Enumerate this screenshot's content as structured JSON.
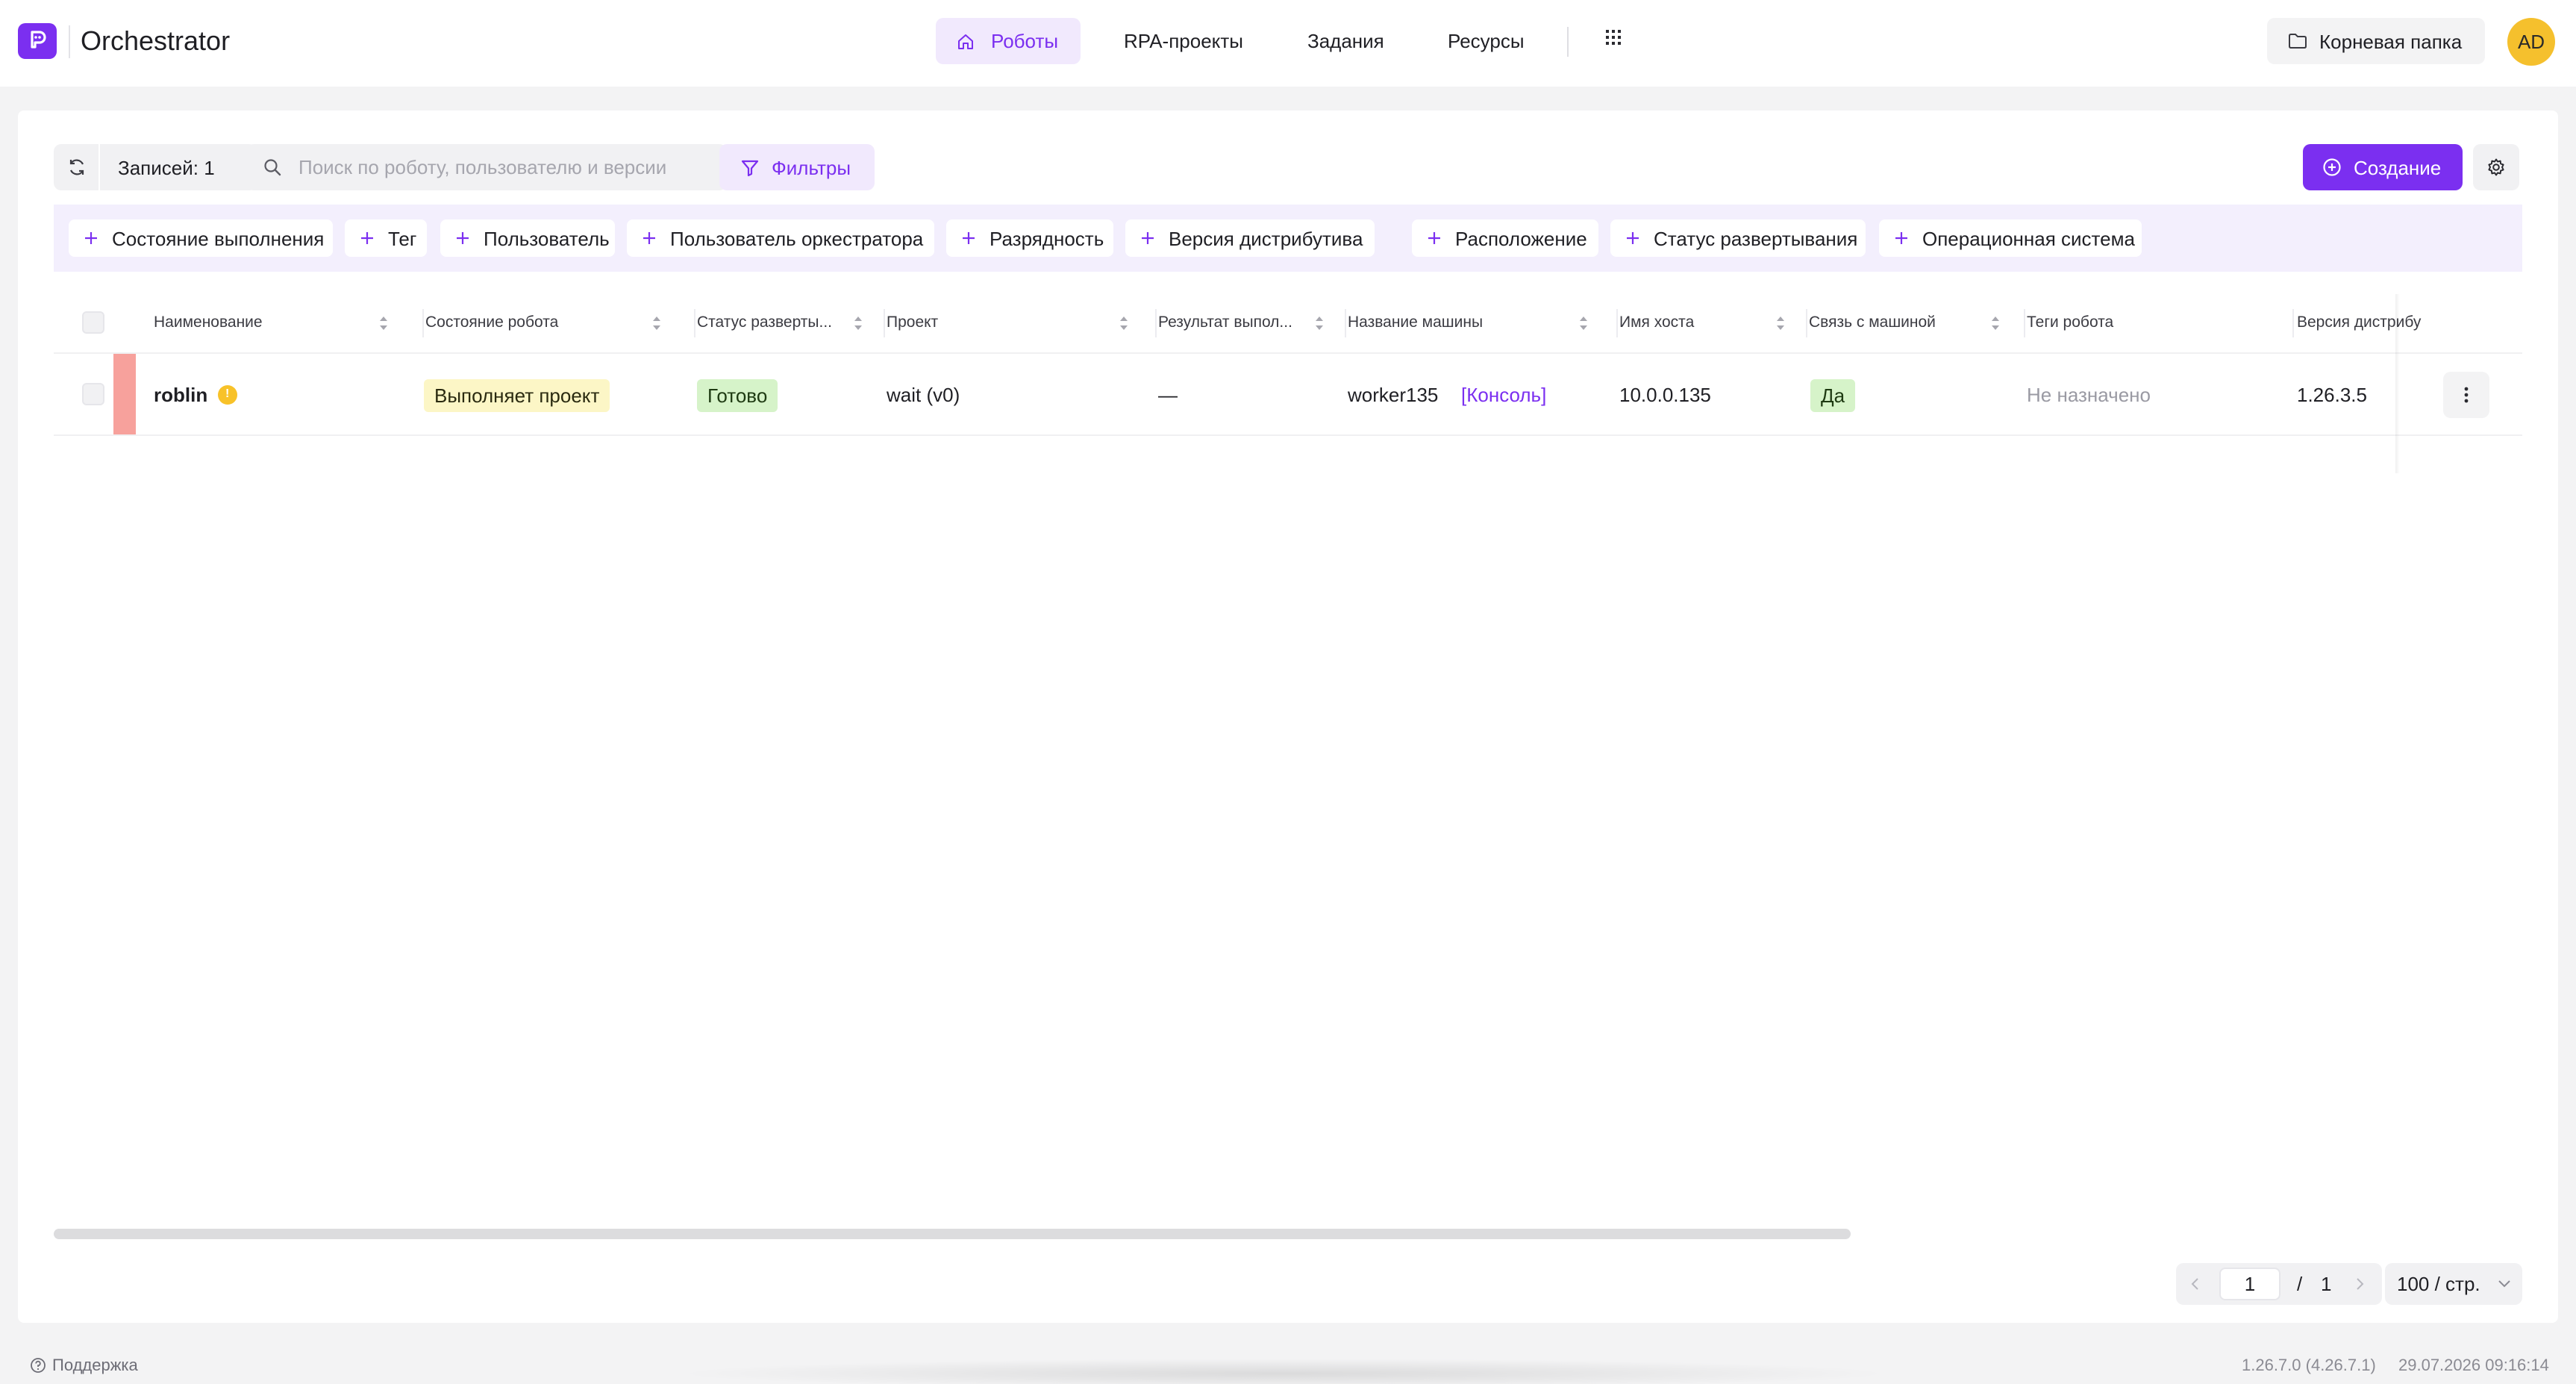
{
  "app": {
    "title": "Orchestrator",
    "accent_color": "#7b2ff0"
  },
  "nav": {
    "items": [
      {
        "label": "Роботы",
        "icon": "home-icon",
        "active": true
      },
      {
        "label": "RPA-проекты",
        "active": false
      },
      {
        "label": "Задания",
        "active": false
      },
      {
        "label": "Ресурсы",
        "active": false
      }
    ],
    "apps_icon": "grid-icon"
  },
  "header": {
    "folder_label": "Корневая папка",
    "avatar_initials": "AD"
  },
  "toolbar": {
    "records_label": "Записей: 1",
    "search_placeholder": "Поиск по роботу, пользователю и версии",
    "search_value": "",
    "filters_label": "Фильтры",
    "create_label": "Создание"
  },
  "filter_chips": [
    "Состояние выполнения",
    "Тег",
    "Пользователь",
    "Пользователь оркестратора",
    "Разрядность",
    "Версия дистрибутива",
    "Расположение",
    "Статус развертывания",
    "Операционная система"
  ],
  "table": {
    "columns": [
      "Наименование",
      "Состояние робота",
      "Статус разверты...",
      "Проект",
      "Результат выпол...",
      "Название машины",
      "Имя хоста",
      "Связь с машиной",
      "Теги робота",
      "Версия дистрибу"
    ],
    "rows": [
      {
        "name": "roblin",
        "robot_state": "Выполняет проект",
        "deploy_status": "Готово",
        "project": "wait (v0)",
        "run_result": "—",
        "machine_name": "worker135",
        "console_link": "[Консоль]",
        "hostname": "10.0.0.135",
        "machine_connection": "Да",
        "robot_tags": "Не назначено",
        "distro_version": "1.26.3.5",
        "status_color": "#f7a19c"
      }
    ]
  },
  "pagination": {
    "current_page": "1",
    "separator": "/",
    "total_pages": "1",
    "per_page": "100 / стр."
  },
  "footer": {
    "support_label": "Поддержка",
    "version": "1.26.7.0 (4.26.7.1)",
    "timestamp": "29.07.2026 09:16:14"
  }
}
